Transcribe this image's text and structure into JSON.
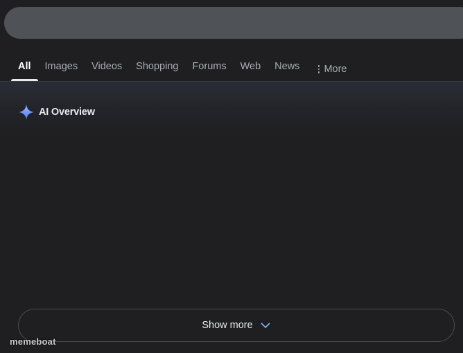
{
  "search": {
    "value": ""
  },
  "tabs": [
    {
      "label": "All",
      "active": true
    },
    {
      "label": "Images",
      "active": false
    },
    {
      "label": "Videos",
      "active": false
    },
    {
      "label": "Shopping",
      "active": false
    },
    {
      "label": "Forums",
      "active": false
    },
    {
      "label": "Web",
      "active": false
    },
    {
      "label": "News",
      "active": false
    }
  ],
  "more_tab": {
    "label": "More",
    "icon": "kebab-vertical-icon"
  },
  "ai_overview": {
    "title": "AI Overview",
    "icon": "gemini-sparkle-icon",
    "sparkle_color_top": "#9bb8ff",
    "sparkle_color_bottom": "#4f7cf0"
  },
  "show_more": {
    "label": "Show more",
    "icon": "chevron-down-icon",
    "chevron_color": "#8ab4f8"
  },
  "watermark": {
    "text": "memeboat"
  },
  "colors": {
    "background": "#1f1f22",
    "search_bar": "#4f5257",
    "tab_inactive": "#a9acb1",
    "tab_active": "#ffffff"
  }
}
